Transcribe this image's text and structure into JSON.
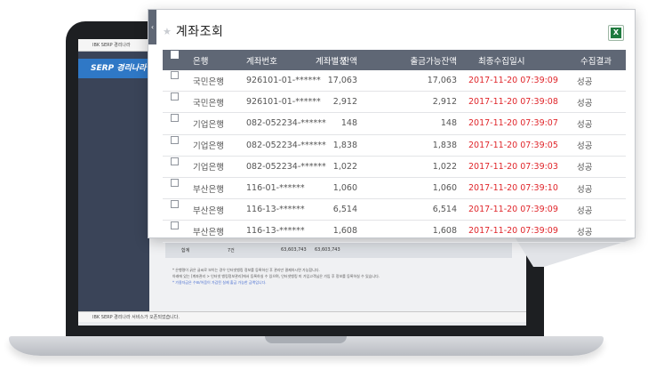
{
  "app": {
    "titlebar": "IBK SERP 경리나라",
    "brand": "SERP 경리나라",
    "statusbar": "IBK SERP 경리나라 서비스가 오픈되었습니다.",
    "summary": {
      "label": "합계",
      "count": "7건",
      "bal": "63,603,743",
      "avail": "63,603,743"
    },
    "notes": [
      "* 은행명이 굵은 글씨로 보이는 경우 인터넷뱅킹 정보를 등록하신 후 관리만 결제하시면 가능합니다.",
      "아래에 있는 [계좌관리 > 인터넷 뱅킹정보관리]에서 등록하실 수 있으며, 인터넷뱅킹 미 가입고객님은 가입 후 정보를 등록하실 수 있습니다.",
      "* 가용자금은 수표/어음이 가감된 실제 출금 가능한 금액입니다."
    ]
  },
  "panel": {
    "title": "계좌조회",
    "collapse_glyph": "‹",
    "star_glyph": "★"
  },
  "grid": {
    "columns": [
      "은행",
      "계좌번호",
      "계좌별칭",
      "잔액",
      "출금가능잔액",
      "최종수집일시",
      "수집결과"
    ],
    "rows": [
      {
        "bank": "국민은행",
        "account": "926101-01-******",
        "alias": "",
        "balance": "17,063",
        "available": "17,063",
        "date": "2017-11-20 07:39:09",
        "result": "성공"
      },
      {
        "bank": "국민은행",
        "account": "926101-01-******",
        "alias": "",
        "balance": "2,912",
        "available": "2,912",
        "date": "2017-11-20 07:39:08",
        "result": "성공"
      },
      {
        "bank": "기업은행",
        "account": "082-052234-******",
        "alias": "",
        "balance": "148",
        "available": "148",
        "date": "2017-11-20 07:39:07",
        "result": "성공"
      },
      {
        "bank": "기업은행",
        "account": "082-052234-******",
        "alias": "",
        "balance": "1,838",
        "available": "1,838",
        "date": "2017-11-20 07:39:05",
        "result": "성공"
      },
      {
        "bank": "기업은행",
        "account": "082-052234-******",
        "alias": "",
        "balance": "1,022",
        "available": "1,022",
        "date": "2017-11-20 07:39:03",
        "result": "성공"
      },
      {
        "bank": "부산은행",
        "account": "116-01-******",
        "alias": "",
        "balance": "1,060",
        "available": "1,060",
        "date": "2017-11-20 07:39:10",
        "result": "성공"
      },
      {
        "bank": "부산은행",
        "account": "116-13-******",
        "alias": "",
        "balance": "6,514",
        "available": "6,514",
        "date": "2017-11-20 07:39:09",
        "result": "성공"
      },
      {
        "bank": "부산은행",
        "account": "116-13-******",
        "alias": "",
        "balance": "1,608",
        "available": "1,608",
        "date": "2017-11-20 07:39:09",
        "result": "성공"
      }
    ]
  },
  "colors": {
    "header_bg": "#5f6775",
    "date_red": "#e0262b",
    "brand_blue": "#2f78c6"
  },
  "icons": {
    "excel": "excel-export-icon",
    "star": "star-icon"
  }
}
